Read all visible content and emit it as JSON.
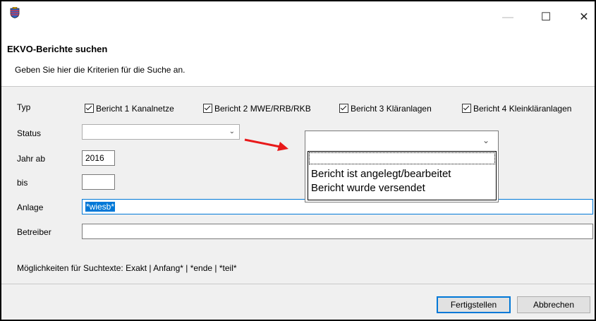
{
  "window": {
    "title_icon": "hesse-coat-of-arms-icon",
    "minimize": "—",
    "maximize": "☐",
    "close": "✕"
  },
  "header": {
    "title": "EKVO-Berichte suchen",
    "subtitle": "Geben Sie hier die Kriterien für die Suche an."
  },
  "form": {
    "typ_label": "Typ",
    "typ_options": [
      "Bericht 1 Kanalnetze",
      "Bericht 2 MWE/RRB/RKB",
      "Bericht 3 Kläranlagen",
      "Bericht 4 Kleinkläranlagen"
    ],
    "status_label": "Status",
    "status_value": "",
    "jahr_ab_label": "Jahr ab",
    "jahr_ab_value": "2016",
    "bis_label": "bis",
    "bis_value": "",
    "anlage_label": "Anlage",
    "anlage_value": "*wiesb*",
    "betreiber_label": "Betreiber",
    "betreiber_value": "",
    "hint": "Möglichkeiten für Suchtexte: Exakt | Anfang* | *ende | *teil*"
  },
  "status_dropdown": {
    "selected": "",
    "options": [
      "",
      "Bericht ist angelegt/bearbeitet",
      "Bericht wurde versendet"
    ]
  },
  "buttons": {
    "finish": "Fertigstellen",
    "cancel": "Abbrechen"
  },
  "colors": {
    "annotation_arrow": "#e8191a",
    "selection": "#0078d7",
    "focus_border": "#0078d7"
  }
}
